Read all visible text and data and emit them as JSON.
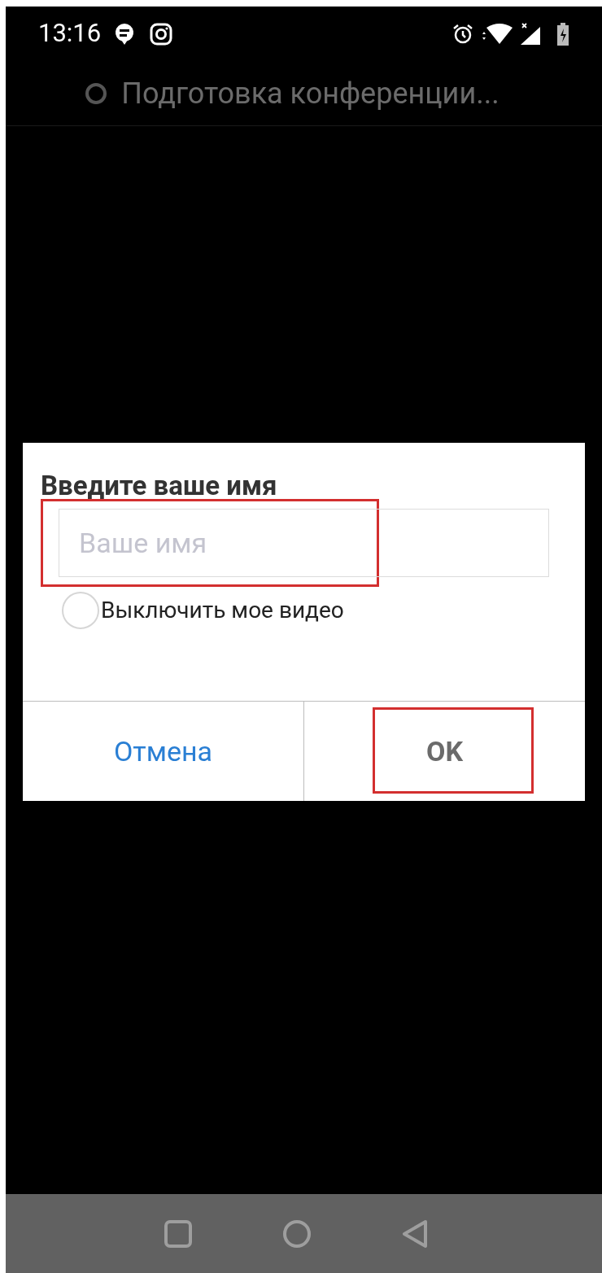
{
  "status_bar": {
    "time": "13:16"
  },
  "title_bar": {
    "title": "Подготовка конференции..."
  },
  "dialog": {
    "title": "Введите ваше имя",
    "name_field": {
      "placeholder": "Ваше имя",
      "highlighted": true
    },
    "video_option": {
      "label": "Выключить мое видео",
      "checked": false
    },
    "buttons": [
      {
        "label": "Отмена",
        "kind": "link",
        "highlighted": false
      },
      {
        "label": "OK",
        "kind": "primary",
        "highlighted": true
      }
    ]
  }
}
